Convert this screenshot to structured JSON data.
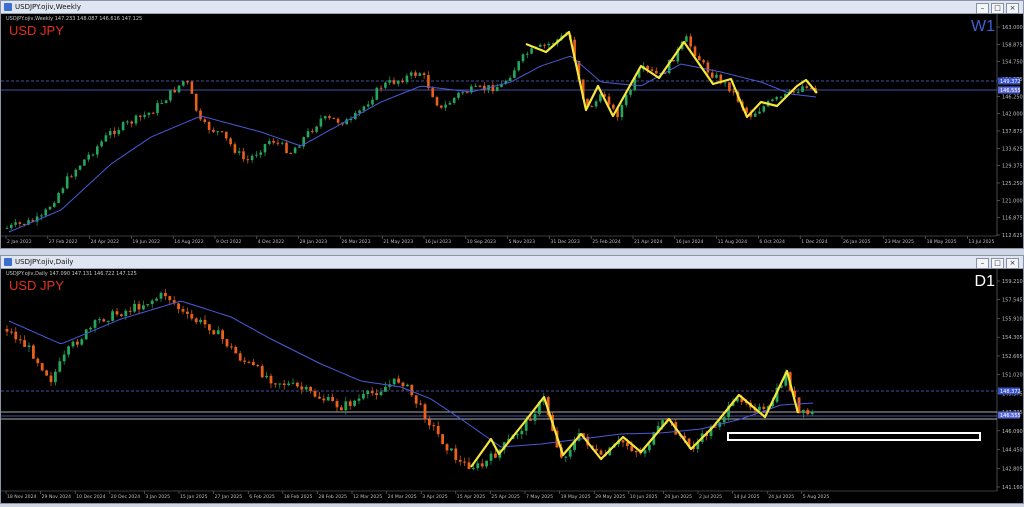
{
  "colors": {
    "bull": "#26a65b",
    "bear": "#e8601c",
    "ma": "#4a5ad8",
    "zigzag": "#f5e63a",
    "symbol": "#e0301e",
    "w1_label": "#3e5fd4",
    "d1_label": "#ffffff"
  },
  "weekly": {
    "window_title": "USDJPY.ojiv,Weekly",
    "ohlc": "USDJPY.ojiv,Weekly  147.233 148.087 146.616 147.125",
    "symbol": "USD JPY",
    "timeframe": "W1",
    "price_labels": [
      "163.000",
      "158.875",
      "154.750",
      "150.375",
      "146.250",
      "142.000",
      "137.875",
      "133.625",
      "129.375",
      "125.250",
      "121.000",
      "116.875",
      "112.625"
    ],
    "tag_upper": "149.372",
    "tag_lower": "146.555",
    "date_labels": [
      "2 Jan 2022",
      "27 Feb 2022",
      "24 Apr 2022",
      "19 Jun 2022",
      "14 Aug 2022",
      "9 Oct 2022",
      "4 Dec 2022",
      "29 Jan 2023",
      "26 Mar 2023",
      "21 May 2023",
      "16 Jul 2023",
      "10 Sep 2023",
      "5 Nov 2023",
      "31 Dec 2023",
      "25 Feb 2024",
      "21 Apr 2024",
      "16 Jun 2024",
      "11 Aug 2024",
      "6 Oct 2024",
      "1 Dec 2024",
      "26 Jan 2025",
      "23 Mar 2025",
      "18 May 2025",
      "13 Jul 2025"
    ]
  },
  "daily": {
    "window_title": "USDJPY.ojiv,Daily",
    "ohlc": "USDJPY.ojiv,Daily  147.090 147.131 146.722 147.125",
    "symbol": "USD JPY",
    "timeframe": "D1",
    "price_labels": [
      "159.210",
      "157.545",
      "155.910",
      "154.305",
      "152.665",
      "151.020",
      "149.375",
      "147.735",
      "146.090",
      "144.450",
      "142.805",
      "141.160"
    ],
    "tag_upper": "148.372",
    "tag_lower": "146.555",
    "date_labels": [
      "18 Nov 2024",
      "29 Nov 2024",
      "10 Dec 2024",
      "20 Dec 2024",
      "3 Jan 2025",
      "15 Jan 2025",
      "27 Jan 2025",
      "6 Feb 2025",
      "18 Feb 2025",
      "28 Feb 2025",
      "12 Mar 2025",
      "24 Mar 2025",
      "3 Apr 2025",
      "15 Apr 2025",
      "25 Apr 2025",
      "7 May 2025",
      "19 May 2025",
      "29 May 2025",
      "10 Jun 2025",
      "20 Jun 2025",
      "2 Jul 2025",
      "14 Jul 2025",
      "24 Jul 2025",
      "5 Aug 2025"
    ]
  }
}
